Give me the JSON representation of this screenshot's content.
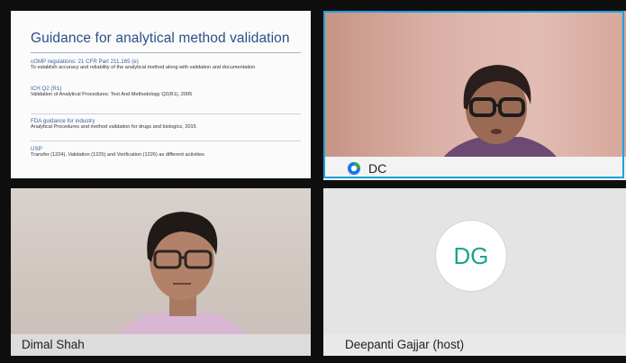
{
  "slide": {
    "title": "Guidance for analytical method validation",
    "sections": [
      {
        "heading": "cGMP regulations: 21 CFR Part 211.165 (e)",
        "text": "To establish accuracy and reliability of the analytical method along with validation and documentation"
      },
      {
        "heading": "ICH Q2 (R1)",
        "text": "Validation of Analytical Procedures: Text And Methodology Q2(R1), 2005"
      },
      {
        "heading": "FDA guidance for industry",
        "text": "Analytical Procedures and method validation for drugs and biologics, 2015"
      },
      {
        "heading": "USP",
        "text": "Transfer (1224), Validation (1225) and Verification (1226) as different activities"
      }
    ]
  },
  "participants": {
    "dc": {
      "name": "DC"
    },
    "dimal": {
      "name": "Dimal Shah"
    },
    "deepanti": {
      "initials": "DG",
      "name": "Deepanti Gajjar (host)"
    }
  },
  "colors": {
    "active_speaker": "#1fa1de",
    "avatar_initials": "#1aa58b",
    "slide_title": "#2b4f86"
  }
}
